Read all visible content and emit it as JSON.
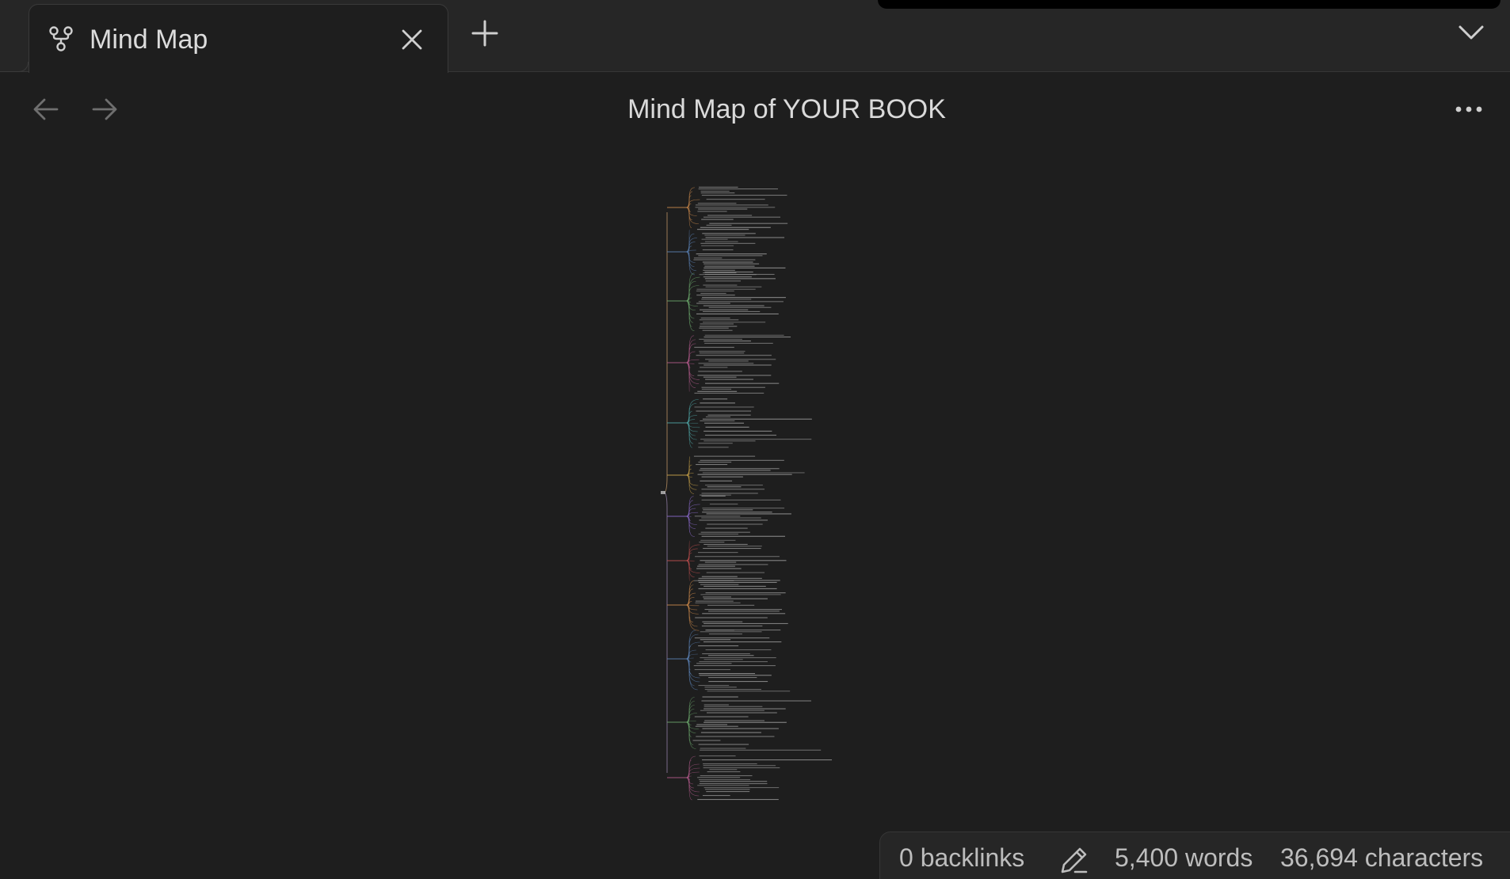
{
  "tab": {
    "title": "Mind Map",
    "icon": "mind-map-icon"
  },
  "tabbar": {
    "new_tab_icon": "plus-icon",
    "tab_list_icon": "chevron-down-icon",
    "close_icon": "close-icon"
  },
  "header": {
    "back_icon": "arrow-left-icon",
    "forward_icon": "arrow-right-icon",
    "title": "Mind Map of YOUR BOOK",
    "more_icon": "more-horizontal-icon"
  },
  "status": {
    "backlinks": "0 backlinks",
    "edit_icon": "pencil-icon",
    "words": "5,400 words",
    "characters": "36,694 characters"
  },
  "colors": {
    "background": "#1e1e1e",
    "tabbar": "#262626",
    "text": "#dadada",
    "muted_icon": "#7a7a7a",
    "branch_colors": [
      "#c6864a",
      "#5a7fb0",
      "#6aa36a",
      "#b05a8a",
      "#4fa3a3",
      "#c9a24a",
      "#8a6ac9",
      "#c05050"
    ]
  }
}
